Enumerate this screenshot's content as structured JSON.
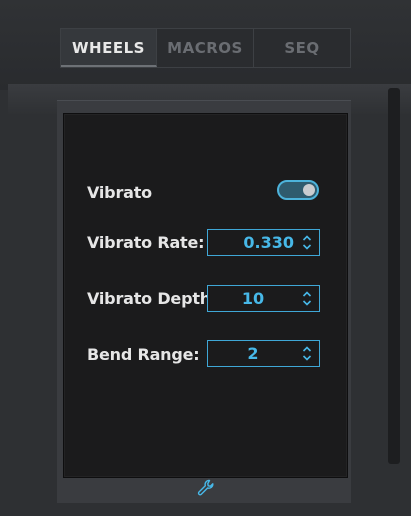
{
  "tabs": [
    {
      "label": "WHEELS",
      "active": true
    },
    {
      "label": "MACROS",
      "active": false
    },
    {
      "label": "SEQ",
      "active": false
    }
  ],
  "settings": {
    "vibrato": {
      "label": "Vibrato",
      "enabled": true
    },
    "vibrato_rate": {
      "label": "Vibrato Rate:",
      "value": "0.330"
    },
    "vibrato_depth": {
      "label": "Vibrato Depth",
      "value": "10"
    },
    "bend_range": {
      "label": "Bend Range:",
      "value": "2"
    }
  },
  "icons": {
    "stepper": "up-down-chevron-icon",
    "footer": "wrench-icon"
  },
  "colors": {
    "accent": "#47b8e8",
    "panel_bg": "#1b1b1c",
    "text": "#e6e6e6",
    "tab_inactive": "#6a6d72"
  }
}
